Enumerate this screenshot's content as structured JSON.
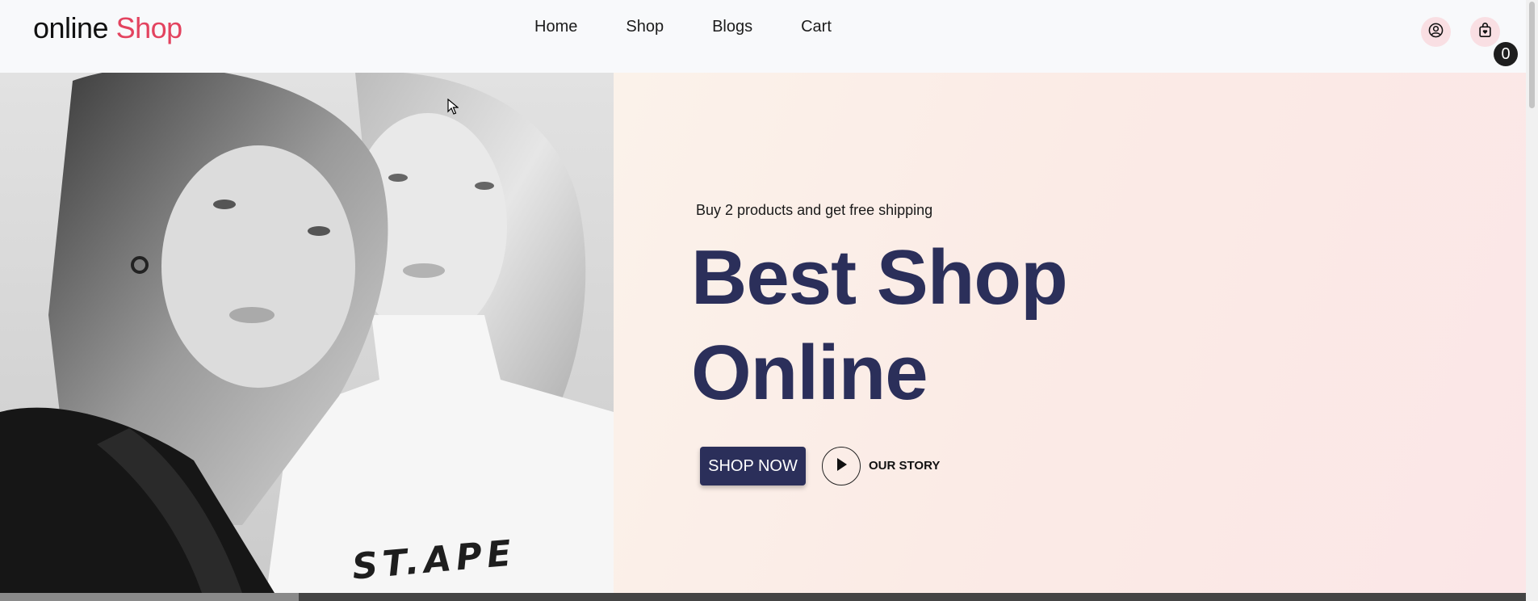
{
  "header": {
    "logo_main": "online",
    "logo_accent": "Shop",
    "nav": [
      "Home",
      "Shop",
      "Blogs",
      "Cart"
    ],
    "cart_count": "0"
  },
  "hero": {
    "subtitle": "Buy 2 products and get free shipping",
    "headline_line1": "Best Shop",
    "headline_line2": "Online",
    "shop_now_label": "SHOP NOW",
    "our_story_label": "OUR STORY",
    "tshirt_text": "ST.APE"
  },
  "icons": {
    "user": "user-circle-icon",
    "cart": "shopping-bag-icon",
    "play": "play-icon"
  },
  "colors": {
    "accent": "#e3435f",
    "headline": "#2b2f5a",
    "button": "#2b2f5a",
    "icon_bg": "#f9dfe3"
  }
}
